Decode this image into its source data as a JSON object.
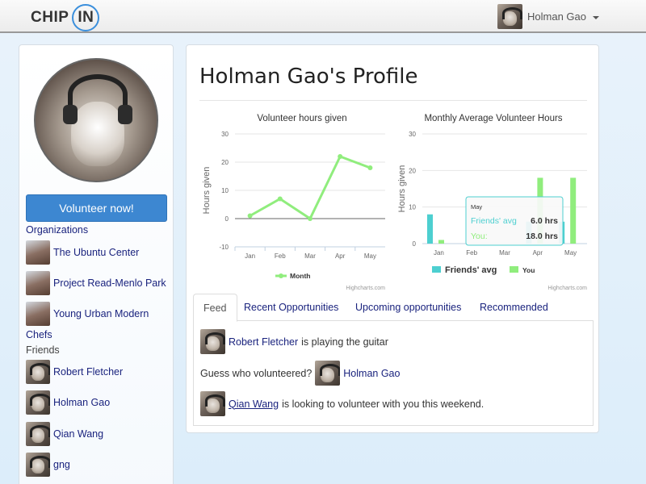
{
  "navbar": {
    "logo_left": "CHIP",
    "logo_right": "IN",
    "user_name": "Holman Gao",
    "user_avatar_icon": "cat-avatar-icon"
  },
  "sidebar": {
    "volunteer_button": "Volunteer now!",
    "organizations_heading": "Organizations",
    "organizations": [
      {
        "name": "The Ubuntu Center"
      },
      {
        "name": "Project Read-Menlo Park"
      },
      {
        "name": "Young Urban Modern",
        "name_cont": "Chefs"
      }
    ],
    "friends_heading": "Friends",
    "friends": [
      {
        "name": "Robert Fletcher"
      },
      {
        "name": "Holman Gao"
      },
      {
        "name": "Qian Wang"
      },
      {
        "name": "gng"
      }
    ]
  },
  "main": {
    "title": "Holman Gao's Profile",
    "tabs": [
      {
        "label": "Feed",
        "active": true
      },
      {
        "label": "Recent Opportunities",
        "active": false
      },
      {
        "label": "Upcoming opportunities",
        "active": false
      },
      {
        "label": "Recommended",
        "active": false
      }
    ],
    "feed": [
      {
        "name": "Robert Fletcher",
        "text": "is playing the guitar"
      },
      {
        "prefix": "Guess who volunteered?",
        "name": "Holman Gao"
      },
      {
        "name": "Qian Wang",
        "text": "is looking to volunteer with you this weekend."
      }
    ]
  },
  "chart_data": [
    {
      "type": "line",
      "title": "Volunteer hours given",
      "ylabel": "Hours given",
      "categories": [
        "Jan",
        "Feb",
        "Mar",
        "Apr",
        "May"
      ],
      "yticks": [
        -10,
        0,
        10,
        20,
        30
      ],
      "ylim": [
        -10,
        30
      ],
      "series": [
        {
          "name": "Month",
          "values": [
            1,
            7,
            0,
            22,
            18
          ],
          "color": "#90ed7d"
        }
      ],
      "credit": "Highcharts.com"
    },
    {
      "type": "bar",
      "title": "Monthly Average Volunteer Hours",
      "ylabel": "Hours given",
      "categories": [
        "Jan",
        "Feb",
        "Mar",
        "Apr",
        "May"
      ],
      "yticks": [
        0,
        10,
        20,
        30
      ],
      "ylim": [
        0,
        30
      ],
      "series": [
        {
          "name": "Friends' avg",
          "values": [
            8,
            0,
            0,
            6,
            6
          ],
          "color": "#4dcfd0"
        },
        {
          "name": "You",
          "values": [
            1,
            0,
            0,
            18,
            18
          ],
          "color": "#90ed7d"
        }
      ],
      "tooltip": {
        "category": "May",
        "lines": [
          {
            "label": "Friends' avg",
            "value": "6.0 hrs"
          },
          {
            "label": "You:",
            "value": "18.0 hrs"
          }
        ]
      },
      "credit": "Highcharts.com"
    }
  ]
}
